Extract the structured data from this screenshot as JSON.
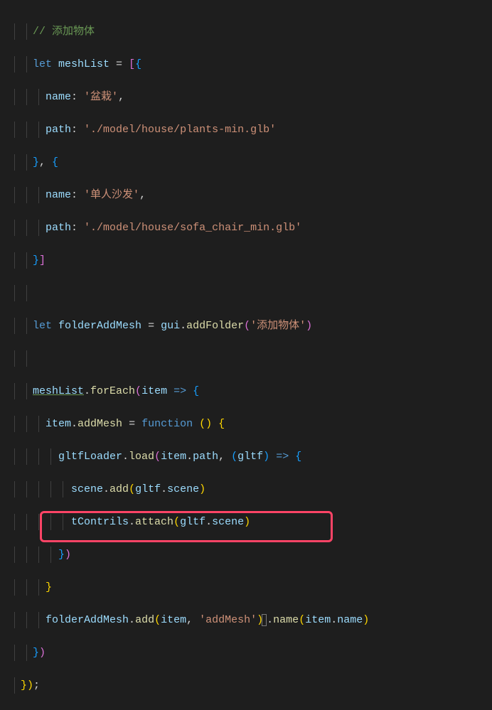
{
  "code": {
    "l1_comment": "// 添加物体",
    "l2_let": "let",
    "l2_var": "meshList",
    "l2_eq": " = ",
    "l2_b1": "[",
    "l2_b2": "{",
    "l3_key": "name",
    "l3_colon": ": ",
    "l3_val": "'盆栽'",
    "l3_comma": ",",
    "l4_key": "path",
    "l4_colon": ": ",
    "l4_val": "'./model/house/plants-min.glb'",
    "l5_b1": "}",
    "l5_comma": ", ",
    "l5_b2": "{",
    "l6_key": "name",
    "l6_colon": ": ",
    "l6_val": "'单人沙发'",
    "l6_comma": ",",
    "l7_key": "path",
    "l7_colon": ": ",
    "l7_val": "'./model/house/sofa_chair_min.glb'",
    "l8_b1": "}",
    "l8_b2": "]",
    "l10_let": "let",
    "l10_var": "folderAddMesh",
    "l10_eq": " = ",
    "l10_gui": "gui",
    "l10_dot": ".",
    "l10_fn": "addFolder",
    "l10_p1": "(",
    "l10_str": "'添加物体'",
    "l10_p2": ")",
    "l12_var": "meshList",
    "l12_dot": ".",
    "l12_fn": "forEach",
    "l12_p1": "(",
    "l12_item": "item",
    "l12_arrow": " => ",
    "l12_b": "{",
    "l13_item": "item",
    "l13_dot": ".",
    "l13_prop": "addMesh",
    "l13_eq": " = ",
    "l13_fn": "function",
    "l13_sp": " ",
    "l13_p1": "(",
    "l13_p2": ")",
    "l13_sp2": " ",
    "l13_b": "{",
    "l14_loader": "gltfLoader",
    "l14_dot": ".",
    "l14_fn": "load",
    "l14_p1": "(",
    "l14_item": "item",
    "l14_dot2": ".",
    "l14_path": "path",
    "l14_comma": ", ",
    "l14_p2": "(",
    "l14_gltf": "gltf",
    "l14_p3": ")",
    "l14_arrow": " => ",
    "l14_b": "{",
    "l15_scene": "scene",
    "l15_dot": ".",
    "l15_fn": "add",
    "l15_p1": "(",
    "l15_gltf": "gltf",
    "l15_dot2": ".",
    "l15_scene2": "scene",
    "l15_p2": ")",
    "l16_tc": "tContrils",
    "l16_dot": ".",
    "l16_fn": "attach",
    "l16_p1": "(",
    "l16_gltf": "gltf",
    "l16_dot2": ".",
    "l16_scene": "scene",
    "l16_p2": ")",
    "l17_b": "}",
    "l17_p": ")",
    "l18_b": "}",
    "l19_var": "folderAddMesh",
    "l19_dot": ".",
    "l19_fn": "add",
    "l19_p1": "(",
    "l19_item": "item",
    "l19_comma": ", ",
    "l19_str": "'addMesh'",
    "l19_p2": ")",
    "l19_dot2": ".",
    "l19_fn2": "name",
    "l19_p3": "(",
    "l19_item2": "item",
    "l19_dot3": ".",
    "l19_name": "name",
    "l19_p4": ")",
    "l20_b": "}",
    "l20_p": ")",
    "l21_b": "}",
    "l21_p": ")",
    "l21_semi": ";"
  }
}
